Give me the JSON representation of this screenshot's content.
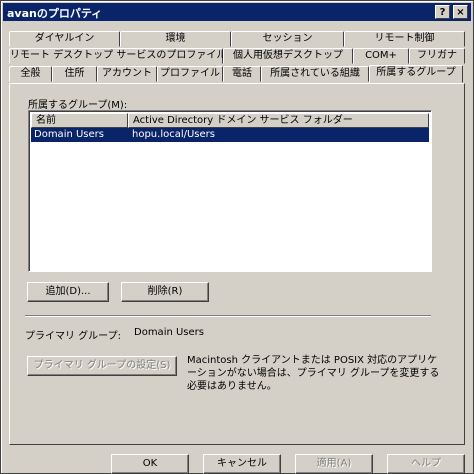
{
  "window": {
    "title": "avanのプロパティ",
    "help_button": "?",
    "close_button": "×"
  },
  "tabs": {
    "row1": [
      "ダイヤルイン",
      "環境",
      "セッション",
      "リモート制御"
    ],
    "row2": [
      "リモート デスクトップ サービスのプロファイル",
      "個人用仮想デスクトップ",
      "COM+",
      "フリガナ"
    ],
    "row3": [
      "全般",
      "住所",
      "アカウント",
      "プロファイル",
      "電話",
      "所属されている組織",
      "所属するグループ"
    ],
    "active": "所属するグループ"
  },
  "groups": {
    "label": "所属するグループ(M):",
    "columns": [
      "名前",
      "Active Directory ドメイン サービス フォルダー"
    ],
    "rows": [
      {
        "name": "Domain Users",
        "folder": "hopu.local/Users",
        "selected": true
      }
    ]
  },
  "buttons": {
    "add": "追加(D)...",
    "remove": "削除(R)",
    "set_primary": "プライマリ グループの設定(S)",
    "ok": "OK",
    "cancel": "キャンセル",
    "apply": "適用(A)",
    "help": "ヘルプ"
  },
  "primary": {
    "label": "プライマリ グループ:",
    "value": "Domain Users",
    "note_line1": "Macintosh クライアントまたは POSIX 対応のアプリケ",
    "note_line2": "ーションがない場合は、プライマリ グループを変更する",
    "note_line3": "必要はありません。"
  },
  "colors": {
    "titlebar": "#0a246a",
    "face": "#d4d0c8",
    "selection": "#0a246a"
  }
}
